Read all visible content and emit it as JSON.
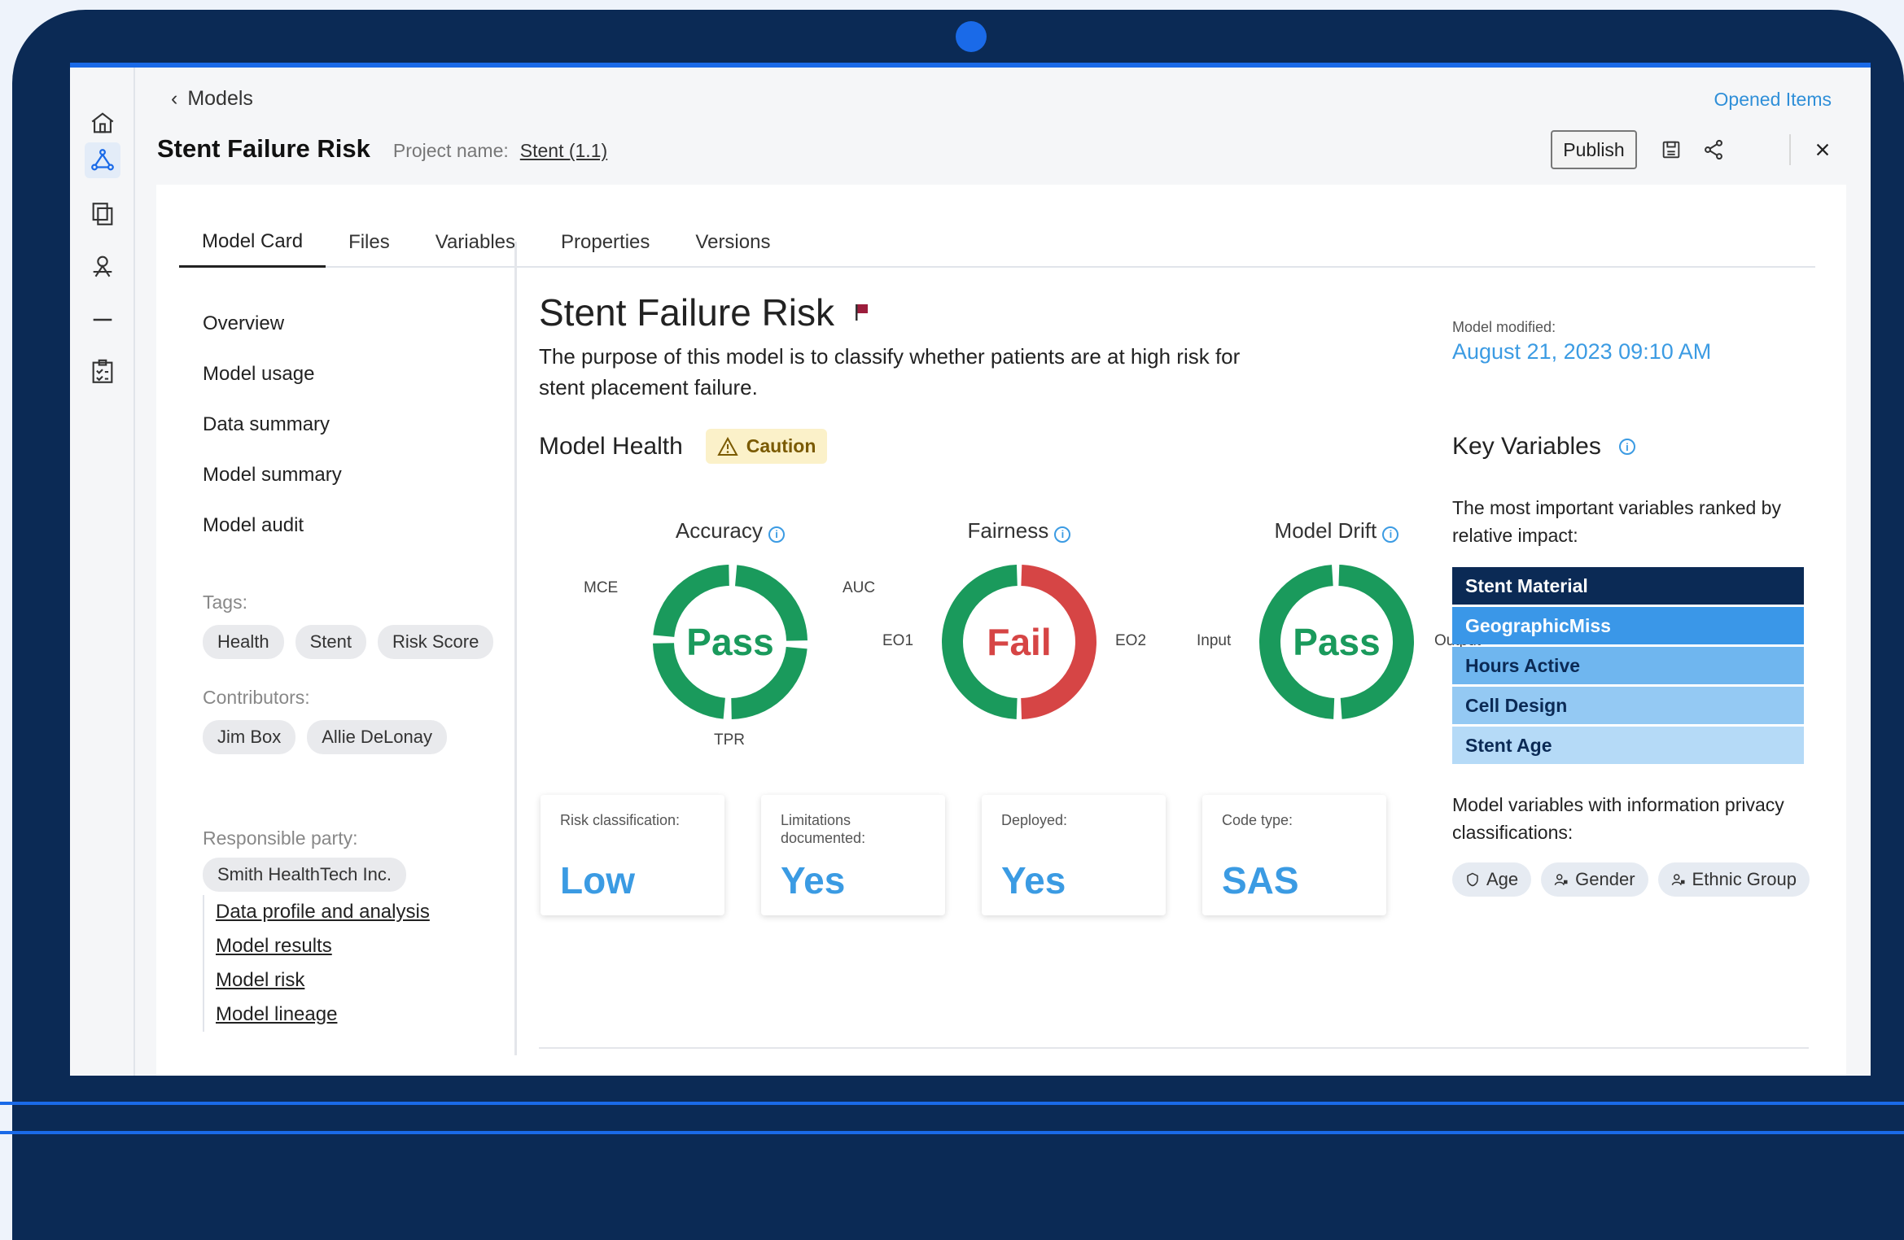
{
  "header": {
    "breadcrumb": "Models",
    "opened_items": "Opened Items",
    "title": "Stent Failure Risk",
    "project_label": "Project name:",
    "project_name": "Stent (1.1)",
    "publish_label": "Publish"
  },
  "rail_icons": [
    "home-icon",
    "model-icon",
    "documents-icon",
    "pipeline-icon",
    "minus-icon",
    "checklist-icon"
  ],
  "tabs": [
    "Model Card",
    "Files",
    "Variables",
    "Properties",
    "Versions"
  ],
  "sidebar": {
    "items": [
      "Overview",
      "Model usage",
      "Data summary",
      "Model summary",
      "Model audit"
    ],
    "tags_label": "Tags:",
    "tags": [
      "Health",
      "Stent",
      "Risk Score"
    ],
    "contributors_label": "Contributors:",
    "contributors": [
      "Jim Box",
      "Allie DeLonay"
    ],
    "responsible_label": "Responsible party:",
    "responsible": "Smith HealthTech Inc.",
    "links": [
      "Data profile and analysis",
      "Model results",
      "Model risk",
      "Model lineage"
    ]
  },
  "main": {
    "title": "Stent Failure Risk",
    "purpose": "The purpose of this model is to classify whether patients are at high risk for stent placement failure.",
    "health_title": "Model Health",
    "health_status": "Caution",
    "gauges": [
      {
        "label": "Accuracy",
        "value": "Pass",
        "left": "MCE",
        "right": "AUC",
        "bottom": "TPR",
        "status_color": "#1a9a5c"
      },
      {
        "label": "Fairness",
        "value": "Fail",
        "left": "EO1",
        "right": "EO2",
        "status_color": "#d64545"
      },
      {
        "label": "Model Drift",
        "value": "Pass",
        "left": "Input",
        "right": "Output",
        "status_color": "#1a9a5c"
      }
    ],
    "stats": [
      {
        "label": "Risk classification:",
        "value": "Low"
      },
      {
        "label": "Limitations documented:",
        "value": "Yes"
      },
      {
        "label": "Deployed:",
        "value": "Yes"
      },
      {
        "label": "Code type:",
        "value": "SAS"
      }
    ]
  },
  "right": {
    "modified_label": "Model modified:",
    "modified_value": "August 21, 2023 09:10 AM",
    "kv_title": "Key Variables",
    "kv_desc": "The most important variables ranked by relative impact:",
    "kv_items": [
      {
        "name": "Stent Material",
        "bg": "#0b2a55",
        "fg": "#ffffff"
      },
      {
        "name": "GeographicMiss",
        "bg": "#3a97e8",
        "fg": "#ffffff"
      },
      {
        "name": "Hours Active",
        "bg": "#6fb6ef",
        "fg": "#0b2a55"
      },
      {
        "name": "Cell Design",
        "bg": "#94c9f3",
        "fg": "#0b2a55"
      },
      {
        "name": "Stent Age",
        "bg": "#b5daf7",
        "fg": "#0b2a55"
      }
    ],
    "privacy_desc": "Model variables with information privacy classifications:",
    "privacy_chips": [
      "Age",
      "Gender",
      "Ethnic Group"
    ]
  },
  "colors": {
    "accent": "#3b9be3",
    "frame": "#0b2a55",
    "pass": "#1a9a5c",
    "fail": "#d64545",
    "caution_bg": "#fbf1c9"
  }
}
